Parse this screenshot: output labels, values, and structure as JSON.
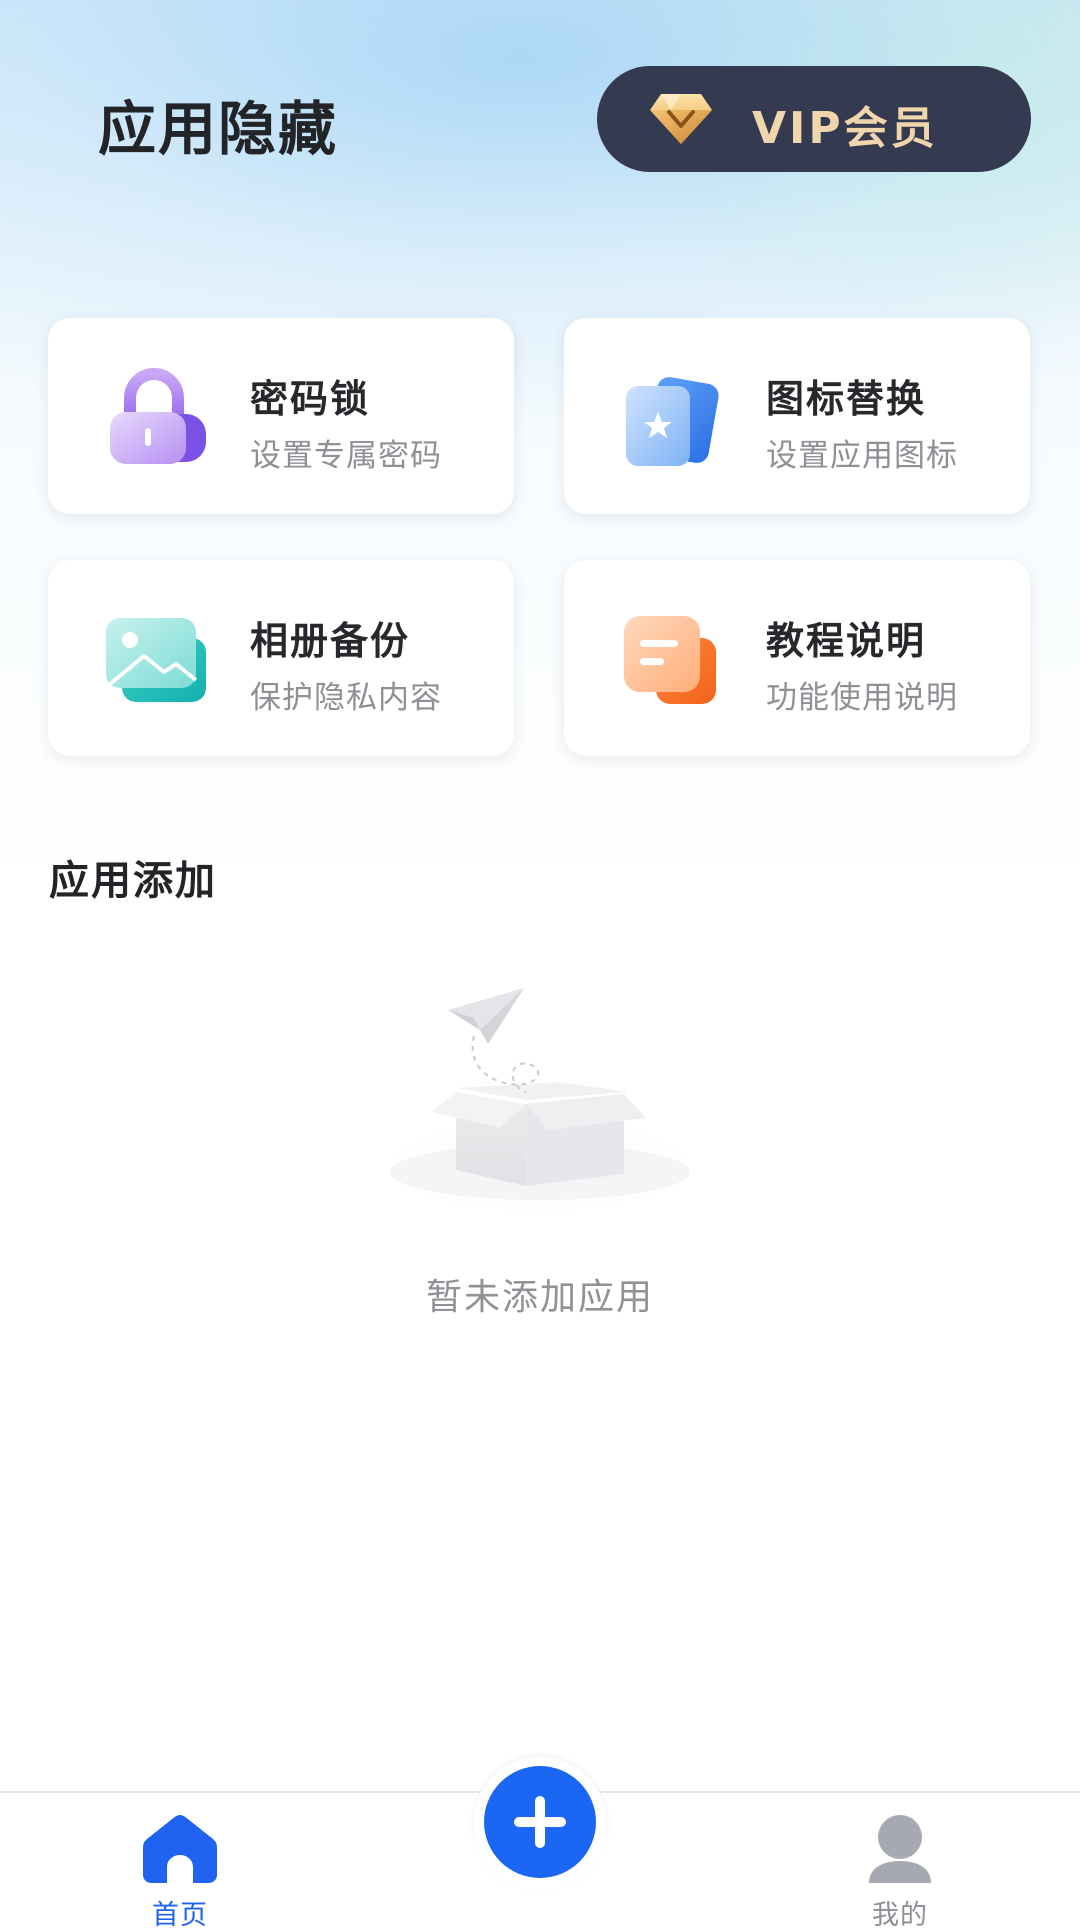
{
  "header": {
    "title": "应用隐藏",
    "vip_label": "VIP会员",
    "vip_icon": "diamond-icon"
  },
  "features": [
    {
      "title": "密码锁",
      "subtitle": "设置专属密码",
      "icon": "lock-icon"
    },
    {
      "title": "图标替换",
      "subtitle": "设置应用图标",
      "icon": "cards-icon"
    },
    {
      "title": "相册备份",
      "subtitle": "保护隐私内容",
      "icon": "image-icon"
    },
    {
      "title": "教程说明",
      "subtitle": "功能使用说明",
      "icon": "document-icon"
    }
  ],
  "section": {
    "title": "应用添加",
    "empty_text": "暂未添加应用",
    "empty_icon": "empty-box-icon"
  },
  "tabbar": {
    "home_label": "首页",
    "mine_label": "我的",
    "add_icon": "plus-icon",
    "active_color": "#1f63f0",
    "inactive_color": "#8b8f96"
  },
  "colors": {
    "vip_bg": "#343a4f",
    "vip_text": "#f1d6ad",
    "accent": "#1b66f2"
  }
}
